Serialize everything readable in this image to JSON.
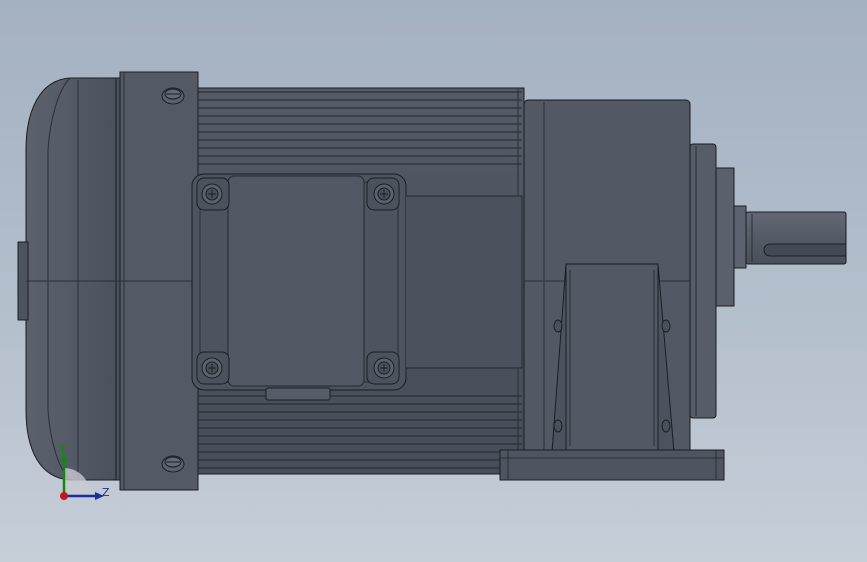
{
  "viewport": {
    "background_top": "#a4b1c1",
    "background_bottom": "#c6ced8"
  },
  "model": {
    "body_color": "#4f5562",
    "edge_color": "#1b1d22",
    "highlight_color": "#6a707d"
  },
  "triad": {
    "y_label": "Y",
    "z_label": "Z",
    "y_color": "#0f8a0f",
    "z_color": "#1c2c9c",
    "origin_color": "#c8161d"
  }
}
